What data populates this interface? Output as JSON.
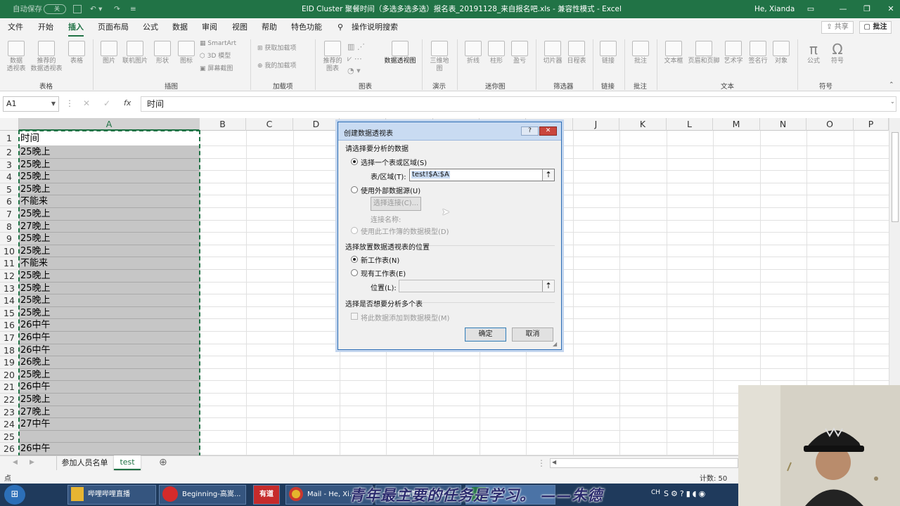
{
  "window": {
    "autosave_label": "自动保存",
    "autosave_state": "关",
    "title": "EID Cluster 聚餐时间（多选多选多选）报名表_20191128_来自报名吧.xls  -  兼容性模式  -  Excel",
    "user": "He, Xianda"
  },
  "ribbon": {
    "tabs": [
      "文件",
      "开始",
      "插入",
      "页面布局",
      "公式",
      "数据",
      "审阅",
      "视图",
      "帮助",
      "特色功能",
      "操作说明搜索"
    ],
    "share": "共享",
    "comment": "批注",
    "buttons": {
      "pivot": "数据\n透视表",
      "rec_pivot": "推荐的\n数据透视表",
      "table": "表格",
      "picture": "图片",
      "online_pic": "联机图片",
      "shapes": "形状",
      "icons": "图标",
      "smartart": "SmartArt",
      "model3d": "3D 模型",
      "screenshot": "屏幕截图",
      "get_addins": "获取加载项",
      "my_addins": "我的加载项",
      "rec_charts": "推荐的\n图表",
      "pivot_chart": "数据透视图",
      "map3d": "三维地\n图",
      "line": "折线",
      "column": "柱形",
      "winloss": "盈亏",
      "slicer": "切片器",
      "timeline": "日程表",
      "link": "链接",
      "comment_btn": "批注",
      "textbox": "文本框",
      "header_footer": "页眉和页脚",
      "wordart": "艺术字",
      "signature": "签名行",
      "object": "对象",
      "equation": "公式",
      "symbol": "符号"
    },
    "groups": [
      "表格",
      "插图",
      "加载项",
      "图表",
      "演示",
      "迷你图",
      "筛选器",
      "链接",
      "批注",
      "文本",
      "符号"
    ]
  },
  "formula_bar": {
    "name_box": "A1",
    "fx": "fx",
    "content": "时间"
  },
  "columns": [
    "A",
    "B",
    "C",
    "D",
    "E",
    "F",
    "G",
    "H",
    "I",
    "J",
    "K",
    "L",
    "M",
    "N",
    "O",
    "P"
  ],
  "rows": [
    {
      "n": "1",
      "a": "时间"
    },
    {
      "n": "2",
      "a": "25晚上"
    },
    {
      "n": "3",
      "a": "25晚上"
    },
    {
      "n": "4",
      "a": "25晚上"
    },
    {
      "n": "5",
      "a": "25晚上"
    },
    {
      "n": "6",
      "a": "不能来"
    },
    {
      "n": "7",
      "a": "25晚上"
    },
    {
      "n": "8",
      "a": "27晚上"
    },
    {
      "n": "9",
      "a": "25晚上"
    },
    {
      "n": "10",
      "a": "25晚上"
    },
    {
      "n": "11",
      "a": "不能来"
    },
    {
      "n": "12",
      "a": "25晚上"
    },
    {
      "n": "13",
      "a": "25晚上"
    },
    {
      "n": "14",
      "a": "25晚上"
    },
    {
      "n": "15",
      "a": "25晚上"
    },
    {
      "n": "16",
      "a": "26中午"
    },
    {
      "n": "17",
      "a": "26中午"
    },
    {
      "n": "18",
      "a": "26中午"
    },
    {
      "n": "19",
      "a": "26晚上"
    },
    {
      "n": "20",
      "a": "25晚上"
    },
    {
      "n": "21",
      "a": "26中午"
    },
    {
      "n": "22",
      "a": "25晚上"
    },
    {
      "n": "23",
      "a": "27晚上"
    },
    {
      "n": "24",
      "a": "27中午"
    },
    {
      "n": "25",
      "a": ""
    },
    {
      "n": "26",
      "a": "26中午"
    }
  ],
  "dialog": {
    "title": "创建数据透视表",
    "help": "?",
    "close": "✕",
    "section1": "请选择要分析的数据",
    "opt_range": "选择一个表或区域(S)",
    "range_label": "表/区域(T):",
    "range_value": "test!$A:$A",
    "opt_external": "使用外部数据源(U)",
    "choose_conn": "选择连接(C)...",
    "conn_name": "连接名称:",
    "opt_model": "使用此工作簿的数据模型(D)",
    "section2": "选择放置数据透视表的位置",
    "opt_new": "新工作表(N)",
    "opt_existing": "现有工作表(E)",
    "location_label": "位置(L):",
    "section3": "选择是否想要分析多个表",
    "add_model": "将此数据添加到数据模型(M)",
    "ok": "确定",
    "cancel": "取消"
  },
  "sheets": [
    "参加人员名单",
    "test"
  ],
  "status": {
    "ready": "点",
    "count": "计数: 50"
  },
  "taskbar": {
    "items": [
      "哔哩哔哩直播",
      "Beginning-高嵩...",
      "有道",
      "Mail - He, Xi...",
      "创建数据透视表",
      ""
    ],
    "caption": "青年最主要的任务是学习。 ——朱德",
    "ime": "CH"
  },
  "colors": {
    "excel_green": "#217346",
    "selection": "#c6c6c6",
    "dialog_title": "#c9dbf2"
  }
}
